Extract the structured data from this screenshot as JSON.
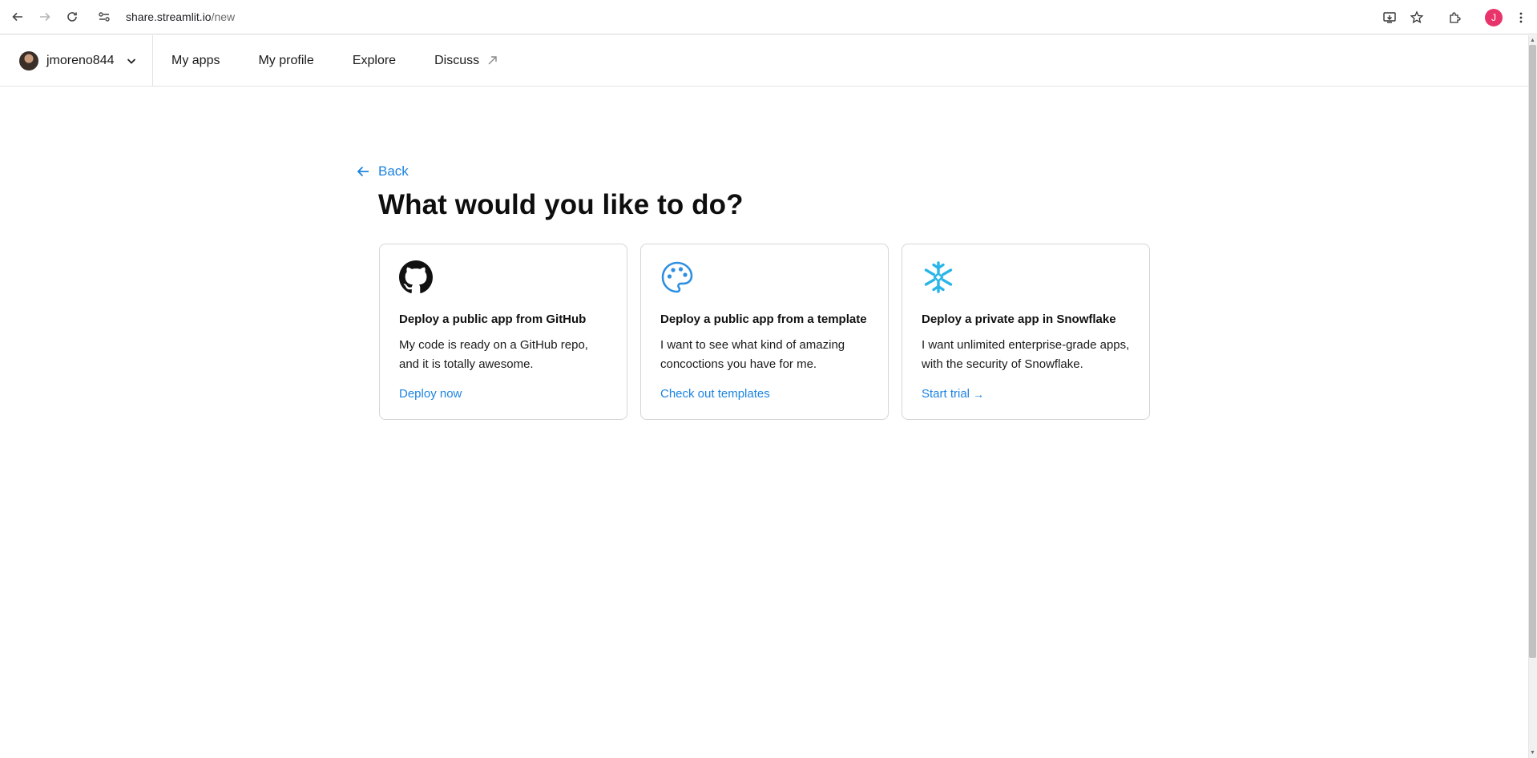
{
  "browser": {
    "url_host": "share.streamlit.io",
    "url_path": "/new",
    "profile_initial": "J"
  },
  "header": {
    "username": "jmoreno844",
    "nav": [
      {
        "label": "My apps"
      },
      {
        "label": "My profile"
      },
      {
        "label": "Explore"
      },
      {
        "label": "Discuss"
      }
    ]
  },
  "main": {
    "back_label": "Back",
    "title": "What would you like to do?",
    "cards": [
      {
        "icon": "github-icon",
        "title": "Deploy a public app from GitHub",
        "description": "My code is ready on a GitHub repo, and it is totally awesome.",
        "link": "Deploy now"
      },
      {
        "icon": "palette-icon",
        "title": "Deploy a public app from a template",
        "description": "I want to see what kind of amazing concoctions you have for me.",
        "link": "Check out templates"
      },
      {
        "icon": "snowflake-icon",
        "title": "Deploy a private app in Snowflake",
        "description": "I want unlimited enterprise-grade apps, with the security of Snowflake.",
        "link": "Start trial",
        "link_arrow": "→"
      }
    ]
  },
  "colors": {
    "link": "#1c83e1",
    "snowflake": "#29b5e8",
    "profile": "#e8346b"
  }
}
